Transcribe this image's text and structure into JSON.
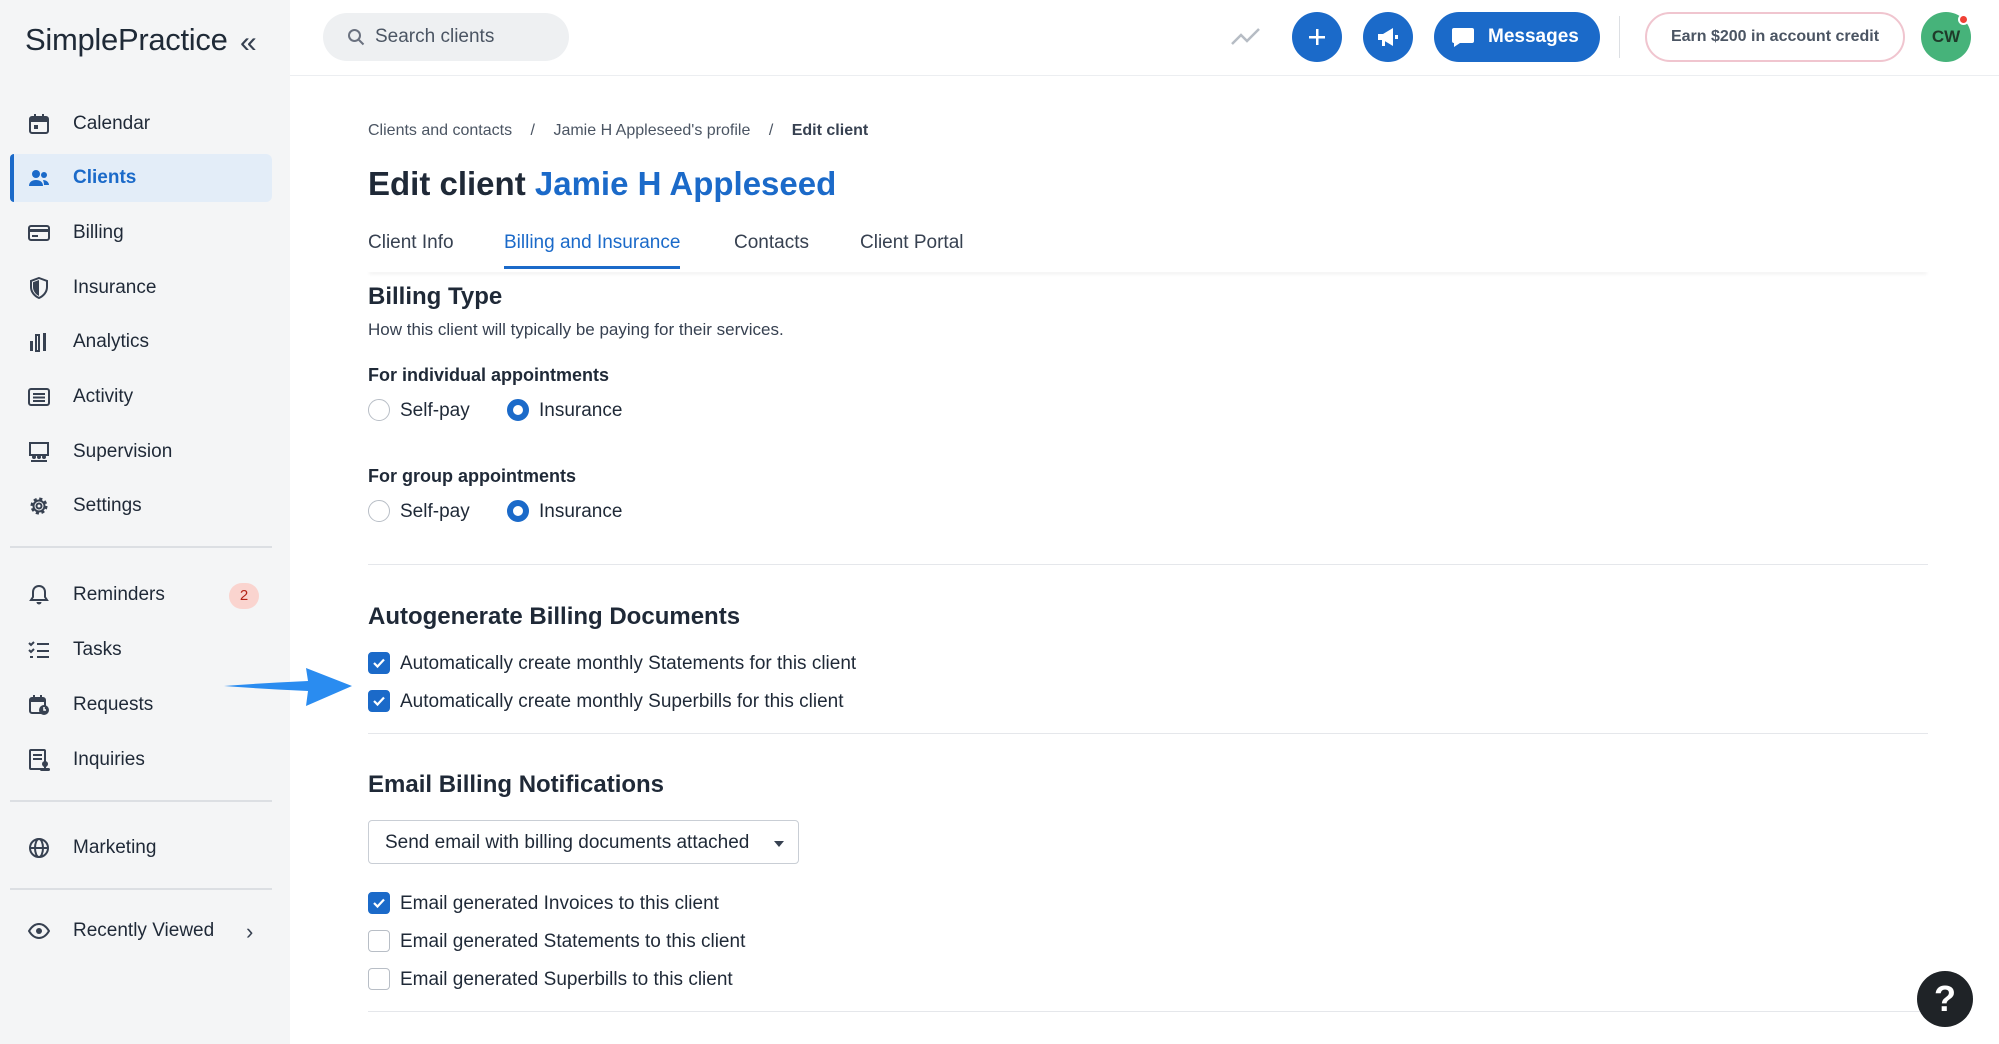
{
  "app": {
    "logo": "SimplePractice"
  },
  "sidebar": {
    "items": [
      {
        "label": "Calendar",
        "icon": "calendar-icon"
      },
      {
        "label": "Clients",
        "icon": "people-icon",
        "active": true
      },
      {
        "label": "Billing",
        "icon": "credit-card-icon"
      },
      {
        "label": "Insurance",
        "icon": "shield-icon"
      },
      {
        "label": "Analytics",
        "icon": "bar-chart-icon"
      },
      {
        "label": "Activity",
        "icon": "list-icon"
      },
      {
        "label": "Supervision",
        "icon": "supervision-icon"
      },
      {
        "label": "Settings",
        "icon": "gear-icon"
      }
    ],
    "secondary": [
      {
        "label": "Reminders",
        "icon": "bell-icon",
        "badge": "2"
      },
      {
        "label": "Tasks",
        "icon": "checklist-icon"
      },
      {
        "label": "Requests",
        "icon": "calendar-request-icon"
      },
      {
        "label": "Inquiries",
        "icon": "inquiry-icon"
      }
    ],
    "marketing": {
      "label": "Marketing",
      "icon": "globe-icon"
    },
    "recently_viewed": {
      "label": "Recently Viewed",
      "icon": "eye-icon"
    }
  },
  "topbar": {
    "search_placeholder": "Search clients",
    "messages_label": "Messages",
    "earn_label": "Earn $200 in account credit",
    "avatar_initials": "CW"
  },
  "breadcrumb": {
    "items": [
      "Clients and contacts",
      "Jamie H Appleseed's profile"
    ],
    "separator": "/",
    "current": "Edit client"
  },
  "page": {
    "title_prefix": "Edit client",
    "client_name": "Jamie H Appleseed"
  },
  "tabs": [
    {
      "label": "Client Info"
    },
    {
      "label": "Billing and Insurance",
      "active": true
    },
    {
      "label": "Contacts"
    },
    {
      "label": "Client Portal"
    }
  ],
  "billing_type": {
    "heading": "Billing Type",
    "description": "How this client will typically be paying for their services.",
    "individual": {
      "label": "For individual appointments",
      "options": [
        "Self-pay",
        "Insurance"
      ],
      "selected": "Insurance"
    },
    "group": {
      "label": "For group appointments",
      "options": [
        "Self-pay",
        "Insurance"
      ],
      "selected": "Insurance"
    }
  },
  "autogenerate": {
    "heading": "Autogenerate Billing Documents",
    "options": [
      {
        "label": "Automatically create monthly Statements for this client",
        "checked": true
      },
      {
        "label": "Automatically create monthly Superbills for this client",
        "checked": true
      }
    ]
  },
  "email_notifications": {
    "heading": "Email Billing Notifications",
    "select_value": "Send email with billing documents attached",
    "options": [
      {
        "label": "Email generated Invoices to this client",
        "checked": true
      },
      {
        "label": "Email generated Statements to this client",
        "checked": false
      },
      {
        "label": "Email generated Superbills to this client",
        "checked": false
      }
    ]
  },
  "help_label": "?",
  "colors": {
    "accent": "#1b6ac9",
    "sidebar_bg": "#f4f5f6",
    "avatar": "#46b37a",
    "badge_bg": "#fad4cf",
    "arrow": "#2a8cf0"
  }
}
